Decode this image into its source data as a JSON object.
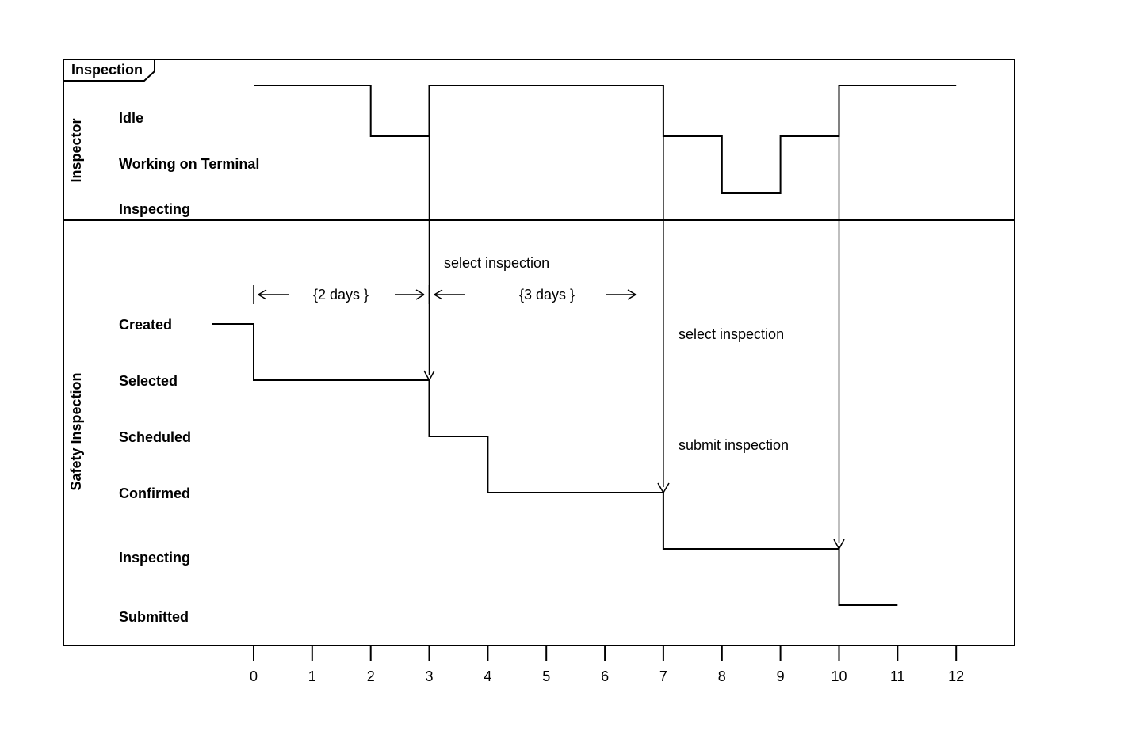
{
  "title_tab": "Inspection",
  "lanes": {
    "inspector": {
      "label": "Inspector",
      "states": [
        "Idle",
        "Working on Terminal",
        "Inspecting"
      ]
    },
    "safety": {
      "label": "Safety Inspection",
      "states": [
        "Created",
        "Selected",
        "Scheduled",
        "Confirmed",
        "Inspecting",
        "Submitted"
      ]
    }
  },
  "annotations": {
    "select_inspection_top": "select inspection",
    "two_days": "{2 days }",
    "three_days": "{3 days }",
    "select_inspection_right": "select inspection",
    "submit_inspection": "submit inspection"
  },
  "axis": [
    "0",
    "1",
    "2",
    "3",
    "4",
    "5",
    "6",
    "7",
    "8",
    "9",
    "10",
    "11",
    "12"
  ],
  "chart_data": {
    "type": "timing",
    "frame_name": "Inspection",
    "time_unit": "days",
    "time_axis": {
      "min": 0,
      "max": 12,
      "ticks": [
        0,
        1,
        2,
        3,
        4,
        5,
        6,
        7,
        8,
        9,
        10,
        11,
        12
      ]
    },
    "lifelines": [
      {
        "name": "Inspector",
        "states": [
          "Idle",
          "Working on Terminal",
          "Inspecting"
        ],
        "segments": [
          {
            "state": "Idle",
            "start": 0,
            "end": 2
          },
          {
            "state": "Working on Terminal",
            "start": 2,
            "end": 3
          },
          {
            "state": "Idle",
            "start": 3,
            "end": 7
          },
          {
            "state": "Working on Terminal",
            "start": 7,
            "end": 8
          },
          {
            "state": "Inspecting",
            "start": 8,
            "end": 9
          },
          {
            "state": "Working on Terminal",
            "start": 9,
            "end": 10
          },
          {
            "state": "Idle",
            "start": 10,
            "end": 12
          }
        ]
      },
      {
        "name": "Safety Inspection",
        "states": [
          "Created",
          "Selected",
          "Scheduled",
          "Confirmed",
          "Inspecting",
          "Submitted"
        ],
        "segments": [
          {
            "state": "Created",
            "start": -0.5,
            "end": 0
          },
          {
            "state": "Selected",
            "start": 0,
            "end": 3
          },
          {
            "state": "Scheduled",
            "start": 3,
            "end": 4
          },
          {
            "state": "Confirmed",
            "start": 4,
            "end": 7
          },
          {
            "state": "Inspecting",
            "start": 7,
            "end": 10
          },
          {
            "state": "Submitted",
            "start": 10,
            "end": 11
          }
        ]
      }
    ],
    "durations": [
      {
        "label": "{2 days }",
        "start": 0,
        "end": 3,
        "lifeline": "Safety Inspection"
      },
      {
        "label": "{3 days }",
        "start": 3,
        "end": 7,
        "lifeline": "Safety Inspection"
      }
    ],
    "messages": [
      {
        "label": "select inspection",
        "at": 3,
        "from": "Inspector",
        "to": "Safety Inspection"
      },
      {
        "label": "select inspection",
        "at": 7,
        "from": "Inspector",
        "to": "Safety Inspection"
      },
      {
        "label": "submit inspection",
        "at": 10,
        "from": "Inspector",
        "to": "Safety Inspection"
      }
    ]
  }
}
